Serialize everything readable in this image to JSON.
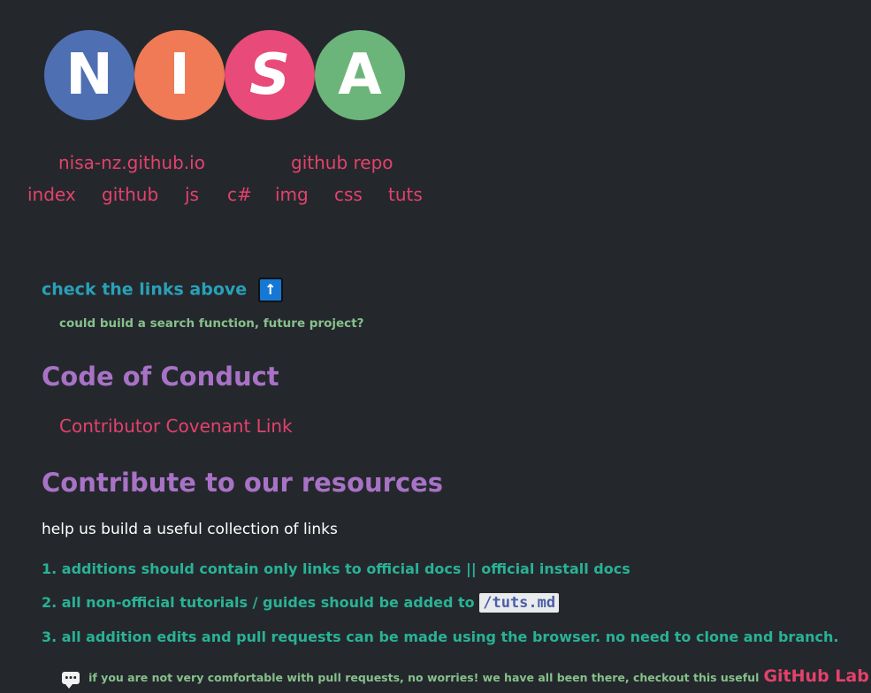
{
  "logo": {
    "letters": [
      "N",
      "I",
      "S",
      "A"
    ],
    "colors": [
      "#4f6fb3",
      "#ef7a55",
      "#e84a7a",
      "#6cb57a"
    ]
  },
  "top_links": {
    "site": "nisa-nz.github.io",
    "repo": "github repo"
  },
  "nav": [
    "index",
    "github",
    "js",
    "c#",
    "img",
    "css",
    "tuts"
  ],
  "check_links": {
    "heading": "check the links above",
    "icon": "up-arrow-icon",
    "note": "could build a search function, future project?"
  },
  "conduct": {
    "heading": "Code of Conduct",
    "link": "Contributor Covenant Link"
  },
  "contribute": {
    "heading": "Contribute to our resources",
    "intro": "help us build a useful collection of links",
    "items": [
      "1. additions should contain only links to official docs || official install docs",
      "2. all non-official tutorials / guides should be added to",
      "3. all addition edits and pull requests can be made using the browser. no need to clone and branch."
    ],
    "item2_code": "/tuts.md",
    "note_icon": "speech-bubble-icon",
    "note": "if you are not very comfortable with pull requests, no worries! we have all been there, checkout this useful",
    "note_link": "GitHub Lab Link"
  },
  "colors": {
    "background": "#24282c",
    "link": "#e5416c",
    "heading_purple": "#a872c6",
    "teal": "#2aa0b8",
    "green": "#29b296"
  }
}
